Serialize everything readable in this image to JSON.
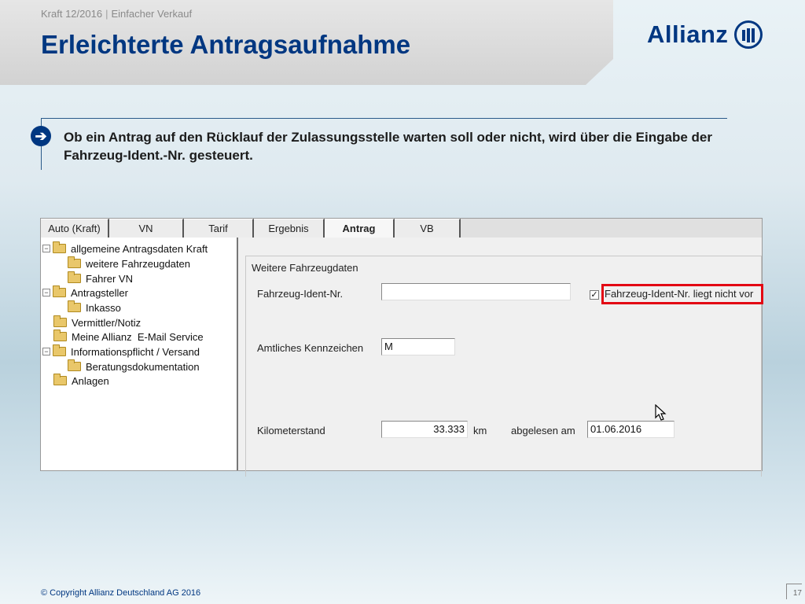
{
  "header": {
    "breadcrumb_left": "Kraft 12/2016",
    "breadcrumb_sep": "|",
    "breadcrumb_right": "Einfacher Verkauf",
    "title": "Erleichterte Antragsaufnahme",
    "logo_text": "Allianz"
  },
  "info": {
    "text": "Ob ein Antrag auf den Rücklauf der Zulassungsstelle warten soll oder nicht, wird über die Eingabe der Fahrzeug-Ident.-Nr. gesteuert."
  },
  "app": {
    "tabs": [
      {
        "label": "Auto (Kraft)"
      },
      {
        "label": "VN"
      },
      {
        "label": "Tarif"
      },
      {
        "label": "Ergebnis"
      },
      {
        "label": "Antrag"
      },
      {
        "label": "VB"
      }
    ],
    "active_tab": "Antrag",
    "tree": [
      {
        "label": "allgemeine Antragsdaten Kraft",
        "expanded": true
      },
      {
        "label": "weitere Fahrzeugdaten"
      },
      {
        "label": "Fahrer VN"
      },
      {
        "label": "Antragsteller",
        "expanded": true
      },
      {
        "label": "Inkasso"
      },
      {
        "label": "Vermittler/Notiz"
      },
      {
        "label": "Meine Allianz  E-Mail Service"
      },
      {
        "label": "Informationspflicht / Versand",
        "expanded": true
      },
      {
        "label": "Beratungsdokumentation"
      },
      {
        "label": "Anlagen"
      }
    ],
    "form": {
      "group_title": "Weitere Fahrzeugdaten",
      "vin_label": "Fahrzeug-Ident-Nr.",
      "vin_value": "",
      "vin_missing_checkbox_label": "Fahrzeug-Ident-Nr. liegt nicht vor",
      "vin_missing_checked": true,
      "plate_label": "Amtliches Kennzeichen",
      "plate_value": "M",
      "mileage_label": "Kilometerstand",
      "mileage_value": "33.333",
      "mileage_unit": "km",
      "read_on_label": "abgelesen am",
      "read_on_value": "01.06.2016"
    }
  },
  "footer": {
    "copyright": "© Copyright Allianz Deutschland AG 2016",
    "page_number": "17"
  },
  "colors": {
    "brand": "#003781",
    "highlight": "#e30613"
  }
}
